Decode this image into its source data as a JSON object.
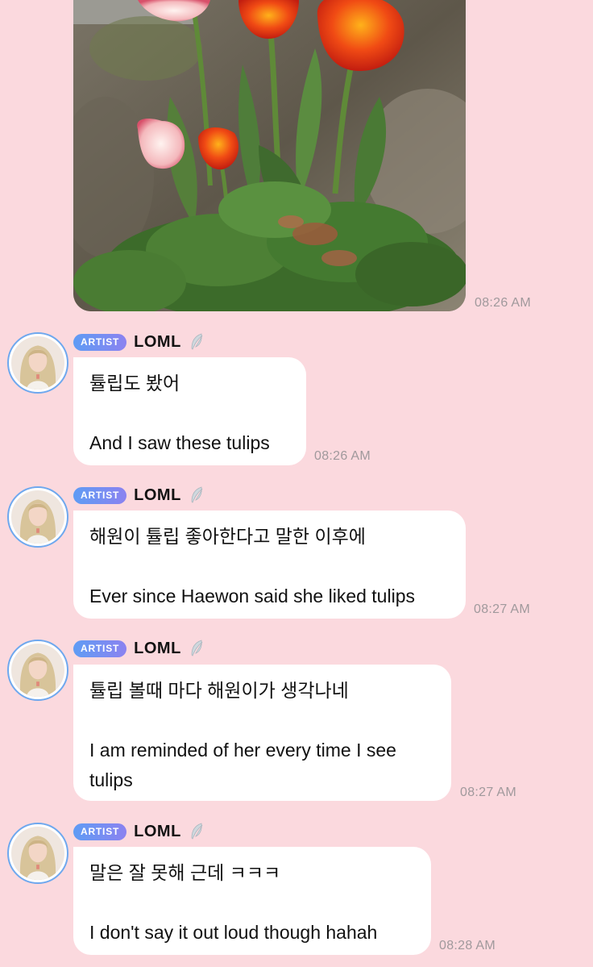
{
  "photo_message": {
    "time": "08:26 AM"
  },
  "messages": [
    {
      "badge": "ARTIST",
      "sender": "LOML",
      "korean": "튤립도 봤어",
      "english": [
        "And I saw these tulips"
      ],
      "time": "08:26 AM"
    },
    {
      "badge": "ARTIST",
      "sender": "LOML",
      "korean": "해원이 튤립 좋아한다고 말한 이후에",
      "english": [
        "Ever since Haewon said she liked tulips"
      ],
      "time": "08:27 AM"
    },
    {
      "badge": "ARTIST",
      "sender": "LOML",
      "korean": "튤립 볼때 마다 해원이가 생각나네",
      "english": [
        "I am reminded of her every time I see",
        "tulips"
      ],
      "time": "08:27 AM"
    },
    {
      "badge": "ARTIST",
      "sender": "LOML",
      "korean": "말은 잘 못해 근데 ㅋㅋㅋ",
      "english": [
        "I don't say it out loud though hahah"
      ],
      "time": "08:28 AM"
    }
  ],
  "icons": {
    "feather": "feather-icon",
    "avatar": "avatar-image"
  },
  "colors": {
    "background": "#fbd9de",
    "bubble": "#ffffff",
    "badge_start": "#5f9cf4",
    "badge_end": "#8b82f0",
    "timestamp": "#a0999c"
  }
}
